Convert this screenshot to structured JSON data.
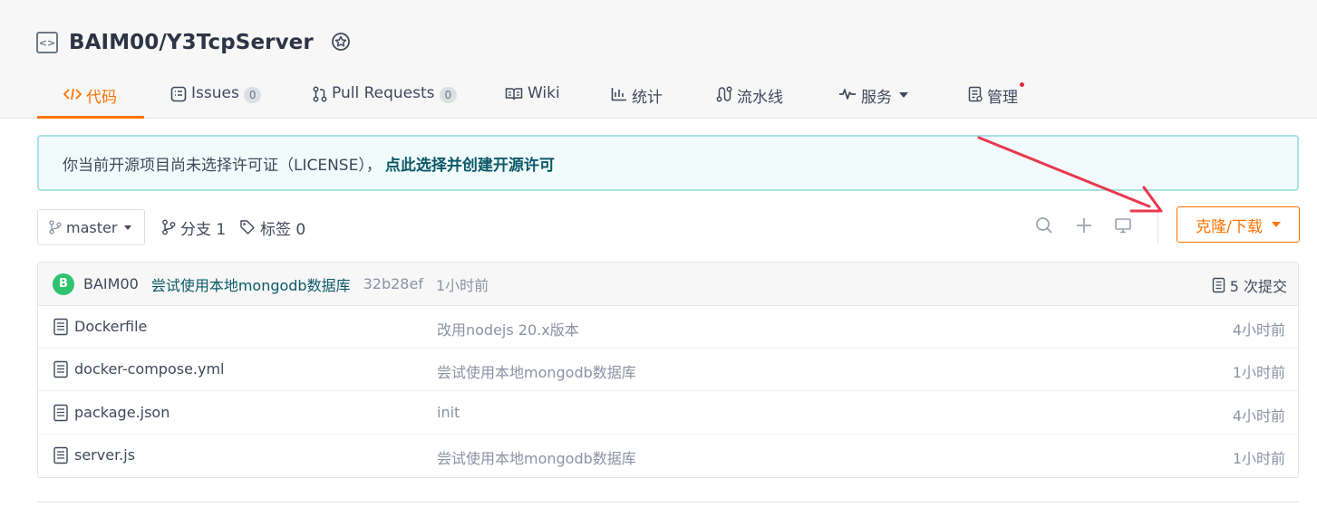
{
  "repo": {
    "title": "BAIM00/Y3TcpServer",
    "code_icon": "code-icon",
    "badge_icon": "award-badge-icon"
  },
  "tabs": [
    {
      "label": "代码",
      "icon": "code-tab-icon",
      "active": true
    },
    {
      "label": "Issues",
      "icon": "issues-icon",
      "count": "0"
    },
    {
      "label": "Pull Requests",
      "icon": "pull-request-icon",
      "count": "0"
    },
    {
      "label": "Wiki",
      "icon": "book-icon"
    },
    {
      "label": "统计",
      "icon": "bar-chart-icon"
    },
    {
      "label": "流水线",
      "icon": "pipeline-icon"
    },
    {
      "label": "服务",
      "icon": "pulse-icon"
    },
    {
      "label": "管理",
      "icon": "manage-icon"
    }
  ],
  "license_notice": {
    "text": "你当前开源项目尚未选择许可证（LICENSE），",
    "link": "点此选择并创建开源许可"
  },
  "toolbar": {
    "branch": "master",
    "branch_count": "分支 1",
    "tag_count": "标签 0",
    "clone_button": "克隆/下载",
    "icons": [
      "search-icon",
      "plus-icon",
      "monitor-icon"
    ]
  },
  "latest_commit": {
    "avatar_letter": "B",
    "author": "BAIM00",
    "message": "尝试使用本地mongodb数据库",
    "hash": "32b28ef",
    "time": "1小时前",
    "commit_count": "5 次提交"
  },
  "files": [
    {
      "name": "Dockerfile",
      "commit": "改用nodejs 20.x版本",
      "time": "4小时前"
    },
    {
      "name": "docker-compose.yml",
      "commit": "尝试使用本地mongodb数据库",
      "time": "1小时前"
    },
    {
      "name": "package.json",
      "commit": "init",
      "time": "4小时前"
    },
    {
      "name": "server.js",
      "commit": "尝试使用本地mongodb数据库",
      "time": "1小时前"
    }
  ],
  "colors": {
    "accent": "#fe7300",
    "link": "#0b5967",
    "annotation": "#e8384f",
    "avatar": "#2ec46d"
  }
}
